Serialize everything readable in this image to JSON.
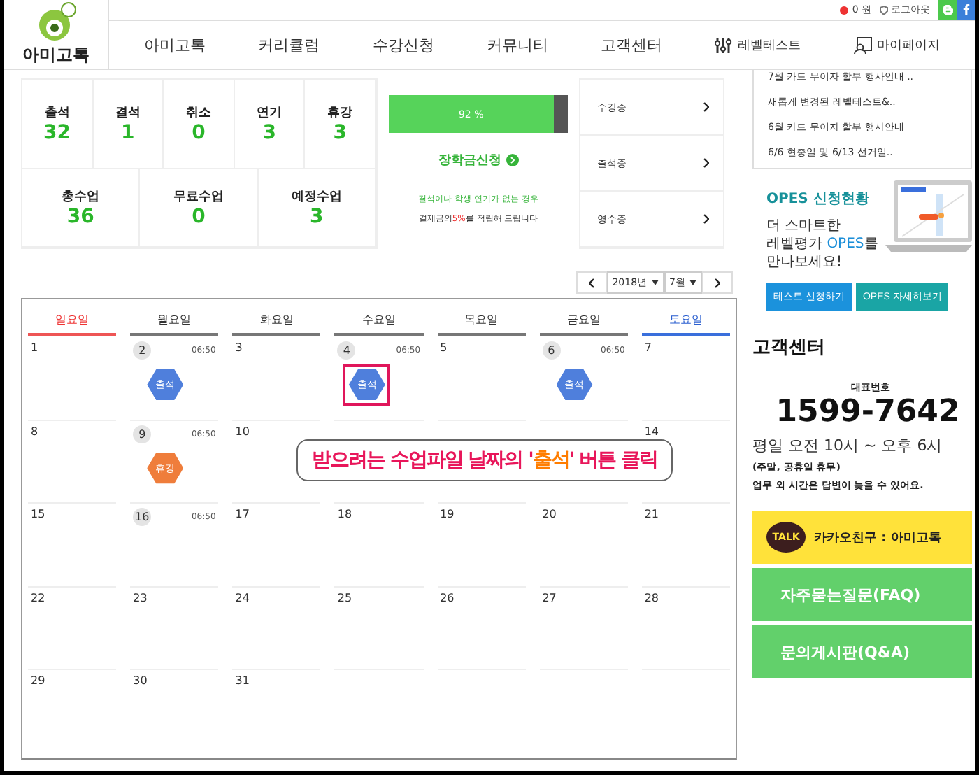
{
  "header": {
    "logo_text": "아미고톡",
    "points": "0 원",
    "logout": "로그아웃",
    "nav": [
      {
        "label": "아미고톡",
        "kind": "text"
      },
      {
        "label": "커리큘럼",
        "kind": "text"
      },
      {
        "label": "수강신청",
        "kind": "text"
      },
      {
        "label": "커뮤니티",
        "kind": "text"
      },
      {
        "label": "고객센터",
        "kind": "text"
      },
      {
        "label": "레벨테스트",
        "kind": "leveltest"
      },
      {
        "label": "마이페이지",
        "kind": "mypage"
      }
    ]
  },
  "stats": {
    "top": [
      {
        "label": "출석",
        "value": "32"
      },
      {
        "label": "결석",
        "value": "1"
      },
      {
        "label": "취소",
        "value": "0"
      },
      {
        "label": "연기",
        "value": "3"
      },
      {
        "label": "휴강",
        "value": "3"
      }
    ],
    "bottom": [
      {
        "label": "총수업",
        "value": "36"
      },
      {
        "label": "무료수업",
        "value": "0"
      },
      {
        "label": "예정수업",
        "value": "3"
      }
    ]
  },
  "attendance": {
    "level": 0.92,
    "reading": "92 %",
    "scholarship_link": "장학금신청",
    "note_line1": "결석이나 학생 연기가 없는 경우",
    "note_line2": "결제금의**5%**를 적립해 드립니다"
  },
  "documents": [
    "수강증",
    "출석증",
    "영수증"
  ],
  "calendar_nav": {
    "year": "2018년",
    "month": "7월"
  },
  "calendar": {
    "weekdays": [
      {
        "label": "일요일",
        "kind": "sunday"
      },
      {
        "label": "월요일",
        "kind": "weekday"
      },
      {
        "label": "화요일",
        "kind": "weekday"
      },
      {
        "label": "수요일",
        "kind": "weekday"
      },
      {
        "label": "목요일",
        "kind": "weekday"
      },
      {
        "label": "금요일",
        "kind": "weekday"
      },
      {
        "label": "토요일",
        "kind": "saturday"
      }
    ],
    "weeks": [
      [
        {
          "day": "1"
        },
        {
          "day": "2",
          "time": "06:50",
          "badge": {
            "label": "출석",
            "kind": "attend",
            "highlighted": false
          }
        },
        {
          "day": "3"
        },
        {
          "day": "4",
          "time": "06:50",
          "badge": {
            "label": "출석",
            "kind": "attend",
            "highlighted": true
          }
        },
        {
          "day": "5"
        },
        {
          "day": "6",
          "time": "06:50",
          "badge": {
            "label": "출석",
            "kind": "attend",
            "highlighted": false
          }
        },
        {
          "day": "7"
        }
      ],
      [
        {
          "day": "8"
        },
        {
          "day": "9",
          "time": "06:50",
          "badge": {
            "label": "휴강",
            "kind": "leave",
            "highlighted": false
          }
        },
        {
          "day": "10"
        },
        {
          "day": "14"
        }
      ],
      [
        {
          "day": "15"
        },
        {
          "day": "16",
          "time": "06:50"
        },
        {
          "day": "17"
        },
        {
          "day": "18"
        },
        {
          "day": "19"
        },
        {
          "day": "20"
        },
        {
          "day": "21"
        }
      ],
      [
        {
          "day": "22"
        },
        {
          "day": "23"
        },
        {
          "day": "24"
        },
        {
          "day": "25"
        },
        {
          "day": "26"
        },
        {
          "day": "27"
        },
        {
          "day": "28"
        }
      ],
      [
        {
          "day": "29"
        },
        {
          "day": "30"
        },
        {
          "day": "31"
        }
      ]
    ],
    "callout": {
      "before": "받으려는 수업파일 날짜의 '",
      "emphasis": "출석",
      "after": "' 버튼 클릭"
    }
  },
  "notices": [
    "7월 카드 무이자 할부 행사안내 ..",
    "새롭게 변경된 레벨테스트&..",
    "6월 카드 무이자 할부 행사안내",
    "6/6 현충일 및 6/13 선거일.."
  ],
  "opes": {
    "title": "OPES 신청현황",
    "text": "더 스마트한\n레벨평가 **OPES**를\n만나보세요!",
    "buttons": [
      {
        "label": "테스트 신청하기",
        "kind": "primary"
      },
      {
        "label": "OPES 자세히보기",
        "kind": "secondary"
      }
    ]
  },
  "support": {
    "title": "고객센터",
    "phone_label": "대표번호",
    "phone": "1599-7642",
    "hours": "평일 오전 10시 ~ 오후 6시",
    "holiday": "(주말, 공휴일 휴무)",
    "note": "업무 외 시간은 답변이 늦을 수 있어요.",
    "links": [
      {
        "label": "카카오친구 : 아미고톡",
        "kind": "kakao",
        "badge": "TALK"
      },
      {
        "label": "자주묻는질문(FAQ)",
        "kind": "faq"
      },
      {
        "label": "문의게시판(Q&A)",
        "kind": "qna"
      }
    ]
  }
}
